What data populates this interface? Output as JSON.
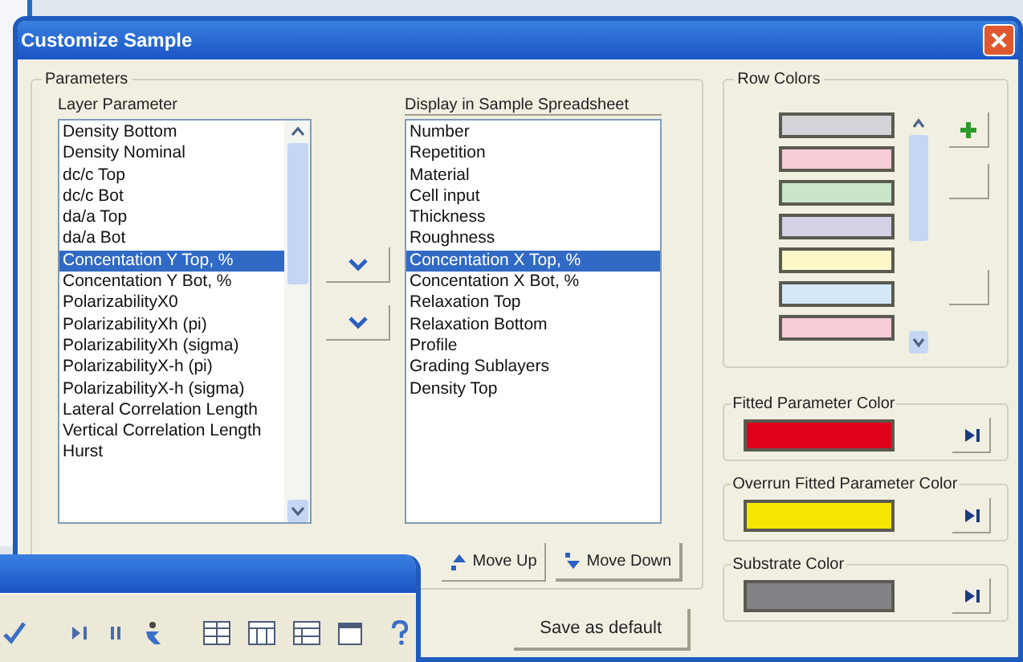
{
  "dialog": {
    "title": "Customize Sample"
  },
  "parameters": {
    "title": "Parameters",
    "layer_list": {
      "label": "Layer Parameter",
      "items": [
        {
          "text": "Density Bottom",
          "selected": false
        },
        {
          "text": "Density Nominal",
          "selected": false
        },
        {
          "text": "dc/c Top",
          "selected": false
        },
        {
          "text": "dc/c Bot",
          "selected": false
        },
        {
          "text": "da/a Top",
          "selected": false
        },
        {
          "text": "da/a Bot",
          "selected": false
        },
        {
          "text": "Concentation Y Top, %",
          "selected": true
        },
        {
          "text": "Concentation Y Bot, %",
          "selected": false
        },
        {
          "text": "PolarizabilityX0",
          "selected": false
        },
        {
          "text": "PolarizabilityXh (pi)",
          "selected": false
        },
        {
          "text": "PolarizabilityXh (sigma)",
          "selected": false
        },
        {
          "text": "PolarizabilityX-h (pi)",
          "selected": false
        },
        {
          "text": "PolarizabilityX-h (sigma)",
          "selected": false
        },
        {
          "text": "Lateral Correlation Length",
          "selected": false
        },
        {
          "text": "Vertical Correlation Length",
          "selected": false
        },
        {
          "text": "Hurst",
          "selected": false
        }
      ]
    },
    "display_list": {
      "label": "Display in Sample Spreadsheet",
      "items": [
        {
          "text": "Number",
          "selected": false
        },
        {
          "text": "Repetition",
          "selected": false
        },
        {
          "text": "Material",
          "selected": false
        },
        {
          "text": "Cell input",
          "selected": false
        },
        {
          "text": "Thickness",
          "selected": false
        },
        {
          "text": "Roughness",
          "selected": false
        },
        {
          "text": "Concentation X Top, %",
          "selected": true
        },
        {
          "text": "Concentation X Bot, %",
          "selected": false
        },
        {
          "text": "Relaxation Top",
          "selected": false
        },
        {
          "text": "Relaxation Bottom",
          "selected": false
        },
        {
          "text": "Profile",
          "selected": false
        },
        {
          "text": "Grading Sublayers",
          "selected": false
        },
        {
          "text": "Density Top",
          "selected": false
        }
      ]
    },
    "buttons": [
      "Move Up",
      "Move Down"
    ]
  },
  "save_button": "Save as default",
  "row_colors": {
    "title": "Row Colors",
    "swatches": [
      {
        "color": "#d4d4d8"
      },
      {
        "color": "#f7cdd6"
      },
      {
        "color": "#c9e6c9"
      },
      {
        "color": "#d4d0e6"
      },
      {
        "color": "#fdf6c8"
      },
      {
        "color": "#d4e8f7"
      },
      {
        "color": "#f7cdd6"
      }
    ]
  },
  "color_groups": [
    {
      "title": "Fitted Parameter Color",
      "color": "#e0001b"
    },
    {
      "title": "Overrun Fitted Parameter Color",
      "color": "#f5e600"
    },
    {
      "title": "Substrate Color",
      "color": "#838387"
    }
  ]
}
